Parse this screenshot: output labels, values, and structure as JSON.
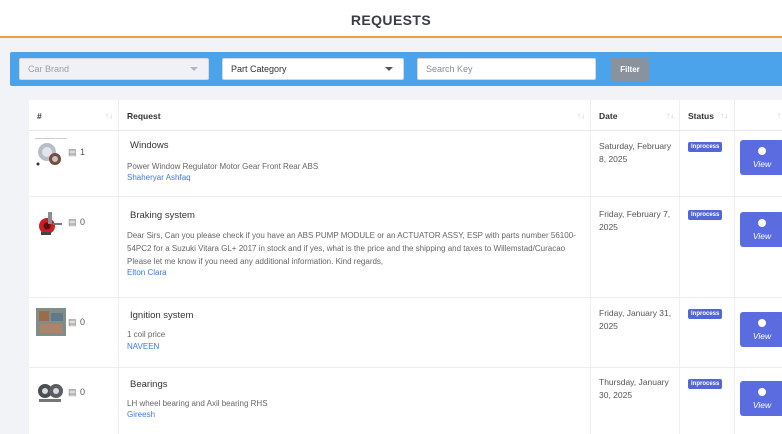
{
  "page": {
    "title": "REQUESTS"
  },
  "filters": {
    "car_brand": "Car Brand",
    "part_category": "Part Category",
    "search_placeholder": "Search Key",
    "filter_label": "Filter"
  },
  "table": {
    "headers": {
      "num": "#",
      "request": "Request",
      "date": "Date",
      "status": "Status"
    },
    "sort_glyph": "↑↓",
    "rows": [
      {
        "messages": "1",
        "title": "Windows",
        "description": "Power Window Regulator Motor Gear Front Rear ABS",
        "user": "Shaheryar Ashfaq",
        "date": "Saturday, February 8, 2025",
        "status": "Inprocess",
        "action": "View"
      },
      {
        "messages": "0",
        "title": "Braking system",
        "description": "Dear Sirs, Can you please check if you have an ABS PUMP MODULE or an ACTUATOR ASSY, ESP with parts number 56100-54PC2 for a Suzuki Vitara GL+ 2017 in stock and if yes, what is the price and the shipping and taxes to Willemstad/Curacao Please let me know if you need any additional information. Kind regards,",
        "user": "Elton Clara",
        "date": "Friday, February 7, 2025",
        "status": "Inprocess",
        "action": "View"
      },
      {
        "messages": "0",
        "title": "Ignition system",
        "description": "1 coil price",
        "user": "NAVEEN",
        "date": "Friday, January 31, 2025",
        "status": "Inprocess",
        "action": "View"
      },
      {
        "messages": "0",
        "title": "Bearings",
        "description": "LH wheel bearing and Axil bearing RHS",
        "user": "Gireesh",
        "date": "Thursday, January 30, 2025",
        "status": "Inprocess",
        "action": "View"
      }
    ]
  },
  "icons": {
    "message": "message-icon",
    "sort": "sort-icon",
    "view": "view-icon"
  },
  "colors": {
    "header_accent": "#f39a3f",
    "filter_bar": "#4ba3ec",
    "status_badge": "#5266d8",
    "view_button": "#5a6ce0",
    "user_link": "#3a7be0"
  }
}
